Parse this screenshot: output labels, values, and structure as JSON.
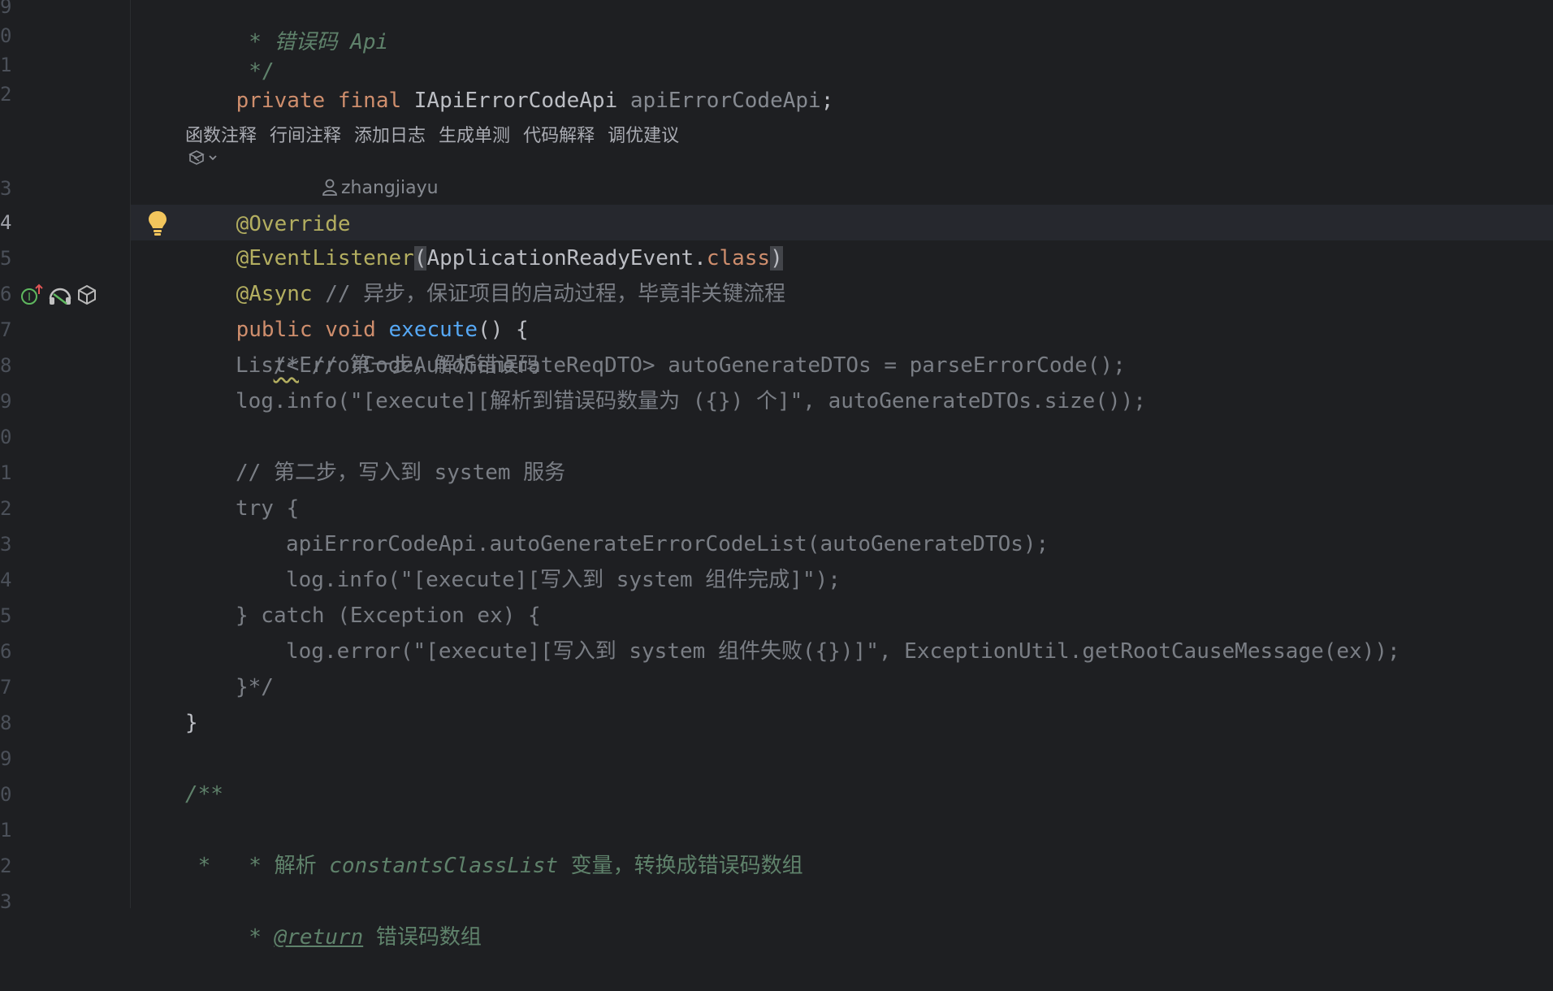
{
  "editor": {
    "line_numbers": [
      "9",
      "0",
      "1",
      "2",
      "3",
      "4",
      "5",
      "6",
      "7",
      "8",
      "9",
      "0",
      "1",
      "2",
      "3",
      "4",
      "5",
      "6",
      "7",
      "8",
      "9",
      "0",
      "1",
      "2",
      "3"
    ],
    "active_line_number": "4",
    "hints": [
      "函数注释",
      "行间注释",
      "添加日志",
      "生成单测",
      "代码解释",
      "调优建议"
    ],
    "author": "zhangjiayu",
    "code": {
      "l0_star": " * ",
      "l0_text": "错误码 Api",
      "l1": " */",
      "l2_private": "private ",
      "l2_final": "final ",
      "l2_type": "IApiErrorCodeApi ",
      "l2_var": "apiErrorCodeApi",
      "l2_semi": ";",
      "override": "@Override",
      "eventlistener": "@EventListener",
      "el_paren_open": "(",
      "el_arg": "ApplicationReadyEvent.",
      "el_class": "class",
      "el_paren_close": ")",
      "async": "@Async",
      "async_comment": " // 异步，保证项目的启动过程，毕竟非关键流程",
      "public": "public ",
      "void": "void ",
      "execute": "execute",
      "execute_rest": "() {",
      "c1_start": "/*",
      "c1_rest": " // 第一步，解析错误码",
      "c2": "List<ErrorCodeAutoGenerateReqDTO> autoGenerateDTOs = parseErrorCode();",
      "c3": "log.info(\"[execute][解析到错误码数量为 ({}) 个]\", autoGenerateDTOs.size());",
      "c4": "// 第二步，写入到 system 服务",
      "c5": "try {",
      "c6": "apiErrorCodeApi.autoGenerateErrorCodeList(autoGenerateDTOs);",
      "c7": "log.info(\"[execute][写入到 system 组件完成]\");",
      "c8": "} catch (Exception ex) {",
      "c9": "log.error(\"[execute][写入到 system 组件失败({})]\", ExceptionUtil.getRootCauseMessage(ex));",
      "c10": "}*/",
      "close_brace": "}",
      "doc_open": "/**",
      "doc_parse_star": " * ",
      "doc_parse_1": "解析 ",
      "doc_parse_var": "constantsClassList",
      "doc_parse_2": " 变量，转换成错误码数组",
      "doc_star": " *",
      "doc_return_star": " * ",
      "doc_return_tag": "@return",
      "doc_return_text": " 错误码数组"
    }
  },
  "colors": {
    "background": "#1e1f22",
    "current_line": "#26282e",
    "keyword": "#cf8e6d",
    "annotation": "#b3ae60",
    "comment": "#7a7e85",
    "doc_comment": "#5f826b",
    "function": "#56a8f5"
  },
  "icons": {
    "bulb": "lightbulb-icon",
    "implements": "implements-up-icon",
    "listener": "event-listener-icon",
    "bean": "bean-icon",
    "ai_assistant": "ai-assistant-icon",
    "person": "person-icon"
  }
}
